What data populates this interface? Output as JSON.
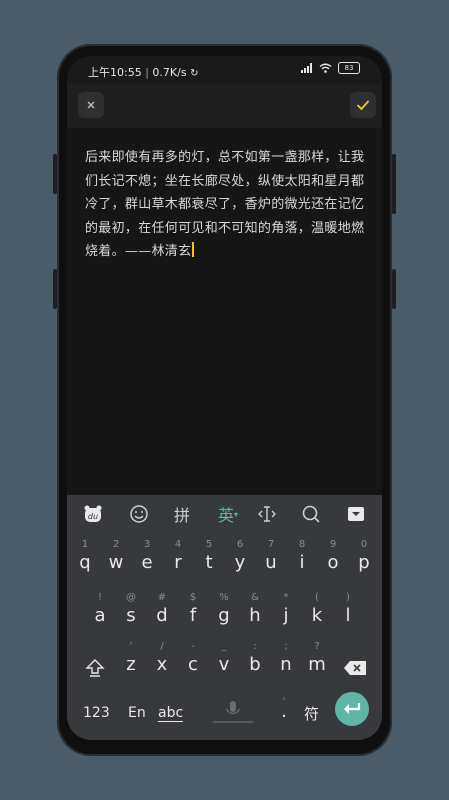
{
  "status_bar": {
    "time": "上午10:55",
    "network_speed": "0.7K/s",
    "battery": "83"
  },
  "toolbar": {
    "close_icon": "close-icon",
    "confirm_icon": "check-icon",
    "accent": "#f3c22f"
  },
  "editor": {
    "text": "后来即使有再多的灯，总不如第一盏那样，让我们长记不熄；坐在长廊尽处，纵使太阳和星月都冷了，群山草木都衰尽了，香炉的微光还在记忆的最初，在任何可见和不可知的角落，温暖地燃烧着。——林清玄"
  },
  "keyboard": {
    "toolbar": {
      "pinyin": "拼",
      "english": "英"
    },
    "row1": [
      {
        "sub": "1",
        "main": "q"
      },
      {
        "sub": "2",
        "main": "w"
      },
      {
        "sub": "3",
        "main": "e"
      },
      {
        "sub": "4",
        "main": "r"
      },
      {
        "sub": "5",
        "main": "t"
      },
      {
        "sub": "6",
        "main": "y"
      },
      {
        "sub": "7",
        "main": "u"
      },
      {
        "sub": "8",
        "main": "i"
      },
      {
        "sub": "9",
        "main": "o"
      },
      {
        "sub": "0",
        "main": "p"
      }
    ],
    "row2": [
      {
        "sub": "!",
        "main": "a"
      },
      {
        "sub": "@",
        "main": "s"
      },
      {
        "sub": "#",
        "main": "d"
      },
      {
        "sub": "$",
        "main": "f"
      },
      {
        "sub": "%",
        "main": "g"
      },
      {
        "sub": "&",
        "main": "h"
      },
      {
        "sub": "*",
        "main": "j"
      },
      {
        "sub": "(",
        "main": "k"
      },
      {
        "sub": ")",
        "main": "l"
      }
    ],
    "row3": [
      {
        "sub": "'",
        "main": "z"
      },
      {
        "sub": "/",
        "main": "x"
      },
      {
        "sub": "-",
        "main": "c"
      },
      {
        "sub": "_",
        "main": "v"
      },
      {
        "sub": ":",
        "main": "b"
      },
      {
        "sub": ";",
        "main": "n"
      },
      {
        "sub": "?",
        "main": "m"
      }
    ],
    "bottom": {
      "num": "123",
      "en": "En",
      "abc": "abc",
      "punct_sub": ",",
      "punct": ".",
      "symbols": "符"
    }
  }
}
